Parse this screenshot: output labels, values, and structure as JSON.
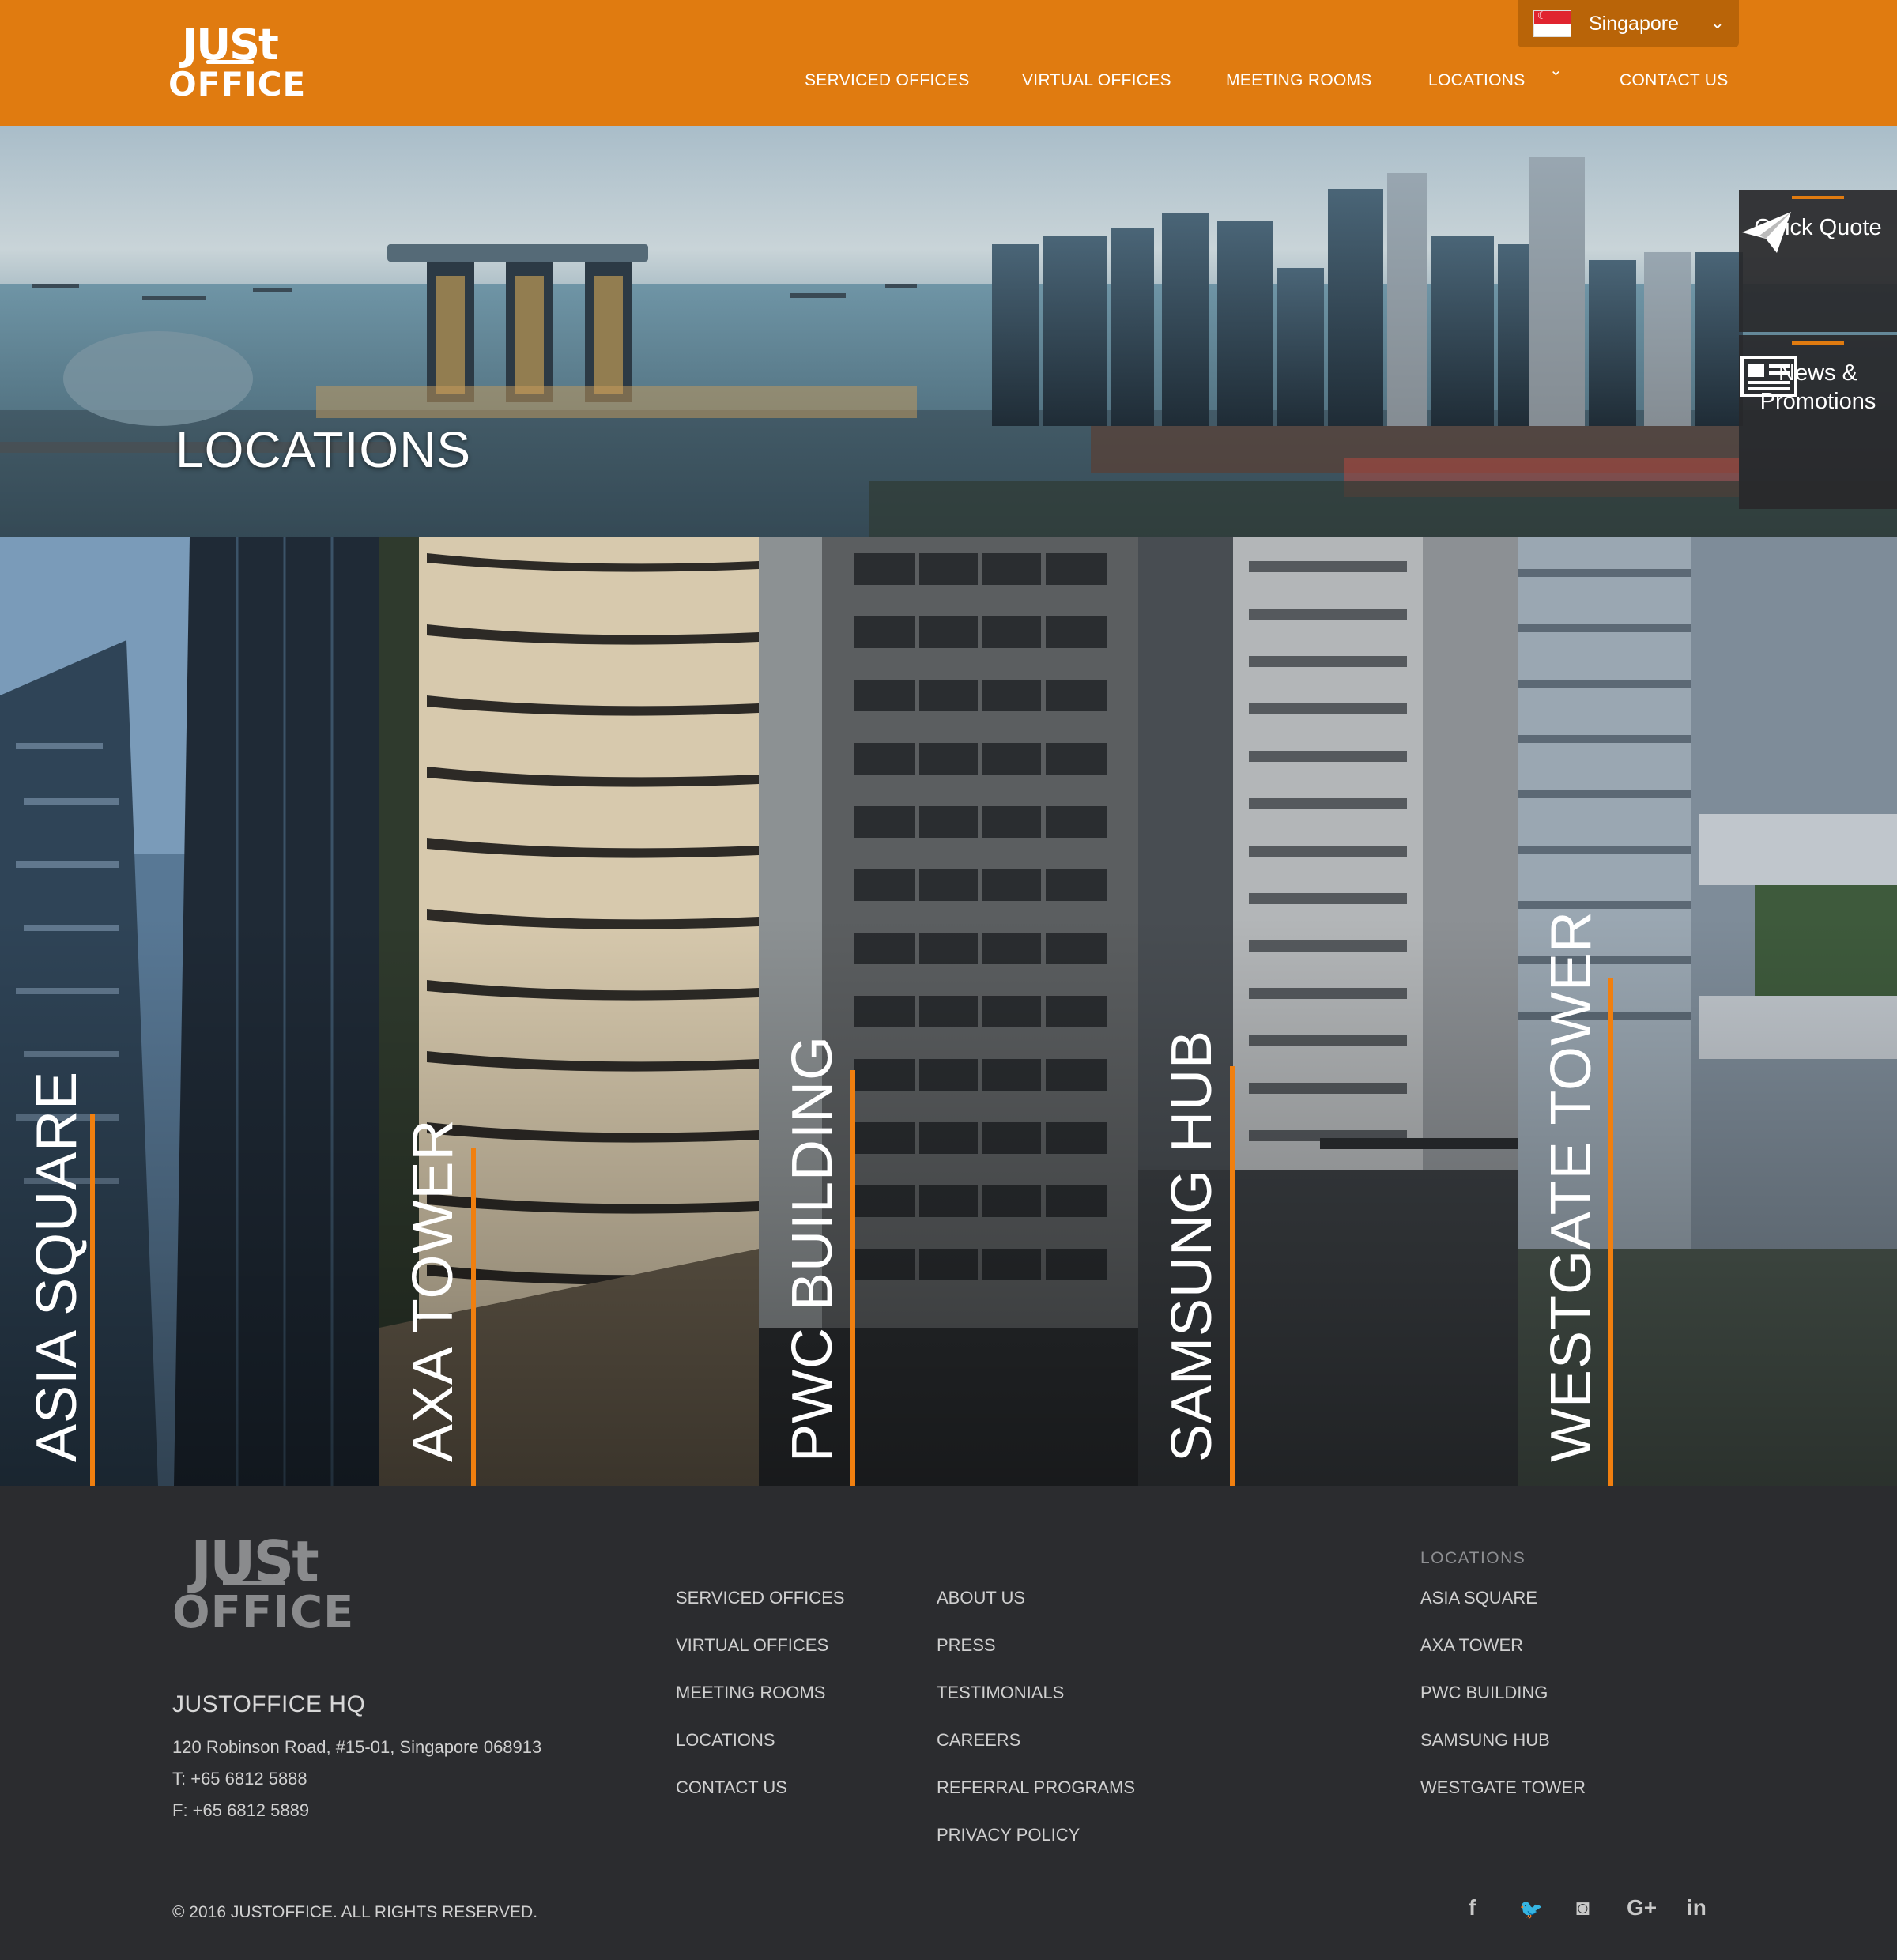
{
  "header": {
    "logo_line1": "JUSt",
    "logo_line2": "OFFICE",
    "country_selector": {
      "label": "Singapore",
      "chevron": "chevron-down-icon",
      "flag": "singapore-flag-icon"
    },
    "nav": [
      {
        "label": "SERVICED OFFICES"
      },
      {
        "label": "VIRTUAL OFFICES"
      },
      {
        "label": "MEETING ROOMS"
      },
      {
        "label": "LOCATIONS",
        "has_dropdown": true
      },
      {
        "label": "CONTACT US"
      }
    ]
  },
  "hero": {
    "title": "LOCATIONS",
    "quick_quote": {
      "label": "Quick Quote",
      "icon": "paper-plane-icon"
    },
    "news": {
      "label_line1": "News &",
      "label_line2": "Promotions",
      "icon": "newspaper-icon"
    }
  },
  "locations": [
    {
      "name": "ASIA SQUARE"
    },
    {
      "name": "AXA TOWER"
    },
    {
      "name": "PWC BUILDING"
    },
    {
      "name": "SAMSUNG HUB"
    },
    {
      "name": "WESTGATE TOWER"
    }
  ],
  "footer": {
    "logo_line1": "JUSt",
    "logo_line2": "OFFICE",
    "hq": {
      "title": "JUSTOFFICE HQ",
      "address": "120 Robinson Road, #15-01, Singapore 068913",
      "phone": "T: +65 6812 5888",
      "fax": "F: +65 6812 5889"
    },
    "col1": [
      "SERVICED OFFICES",
      "VIRTUAL OFFICES",
      "MEETING ROOMS",
      "LOCATIONS",
      "CONTACT US"
    ],
    "col2": [
      "ABOUT US",
      "PRESS",
      "TESTIMONIALS",
      "CAREERS",
      "REFERRAL PROGRAMS",
      "PRIVACY POLICY"
    ],
    "locations_heading": "LOCATIONS",
    "col3": [
      "ASIA SQUARE",
      "AXA TOWER",
      "PWC BUILDING",
      "SAMSUNG HUB",
      "WESTGATE TOWER"
    ],
    "copyright": "© 2016 JUSTOFFICE. ALL RIGHTS RESERVED.",
    "social": [
      {
        "icon": "facebook-icon",
        "glyph": "f"
      },
      {
        "icon": "twitter-icon",
        "glyph": "🐦"
      },
      {
        "icon": "instagram-icon",
        "glyph": "◙"
      },
      {
        "icon": "google-plus-icon",
        "glyph": "G+"
      },
      {
        "icon": "linkedin-icon",
        "glyph": "in"
      }
    ]
  },
  "colors": {
    "brand_orange": "#e07b10",
    "accent_line": "#f07f0f",
    "footer_bg": "#2b2c2f"
  }
}
